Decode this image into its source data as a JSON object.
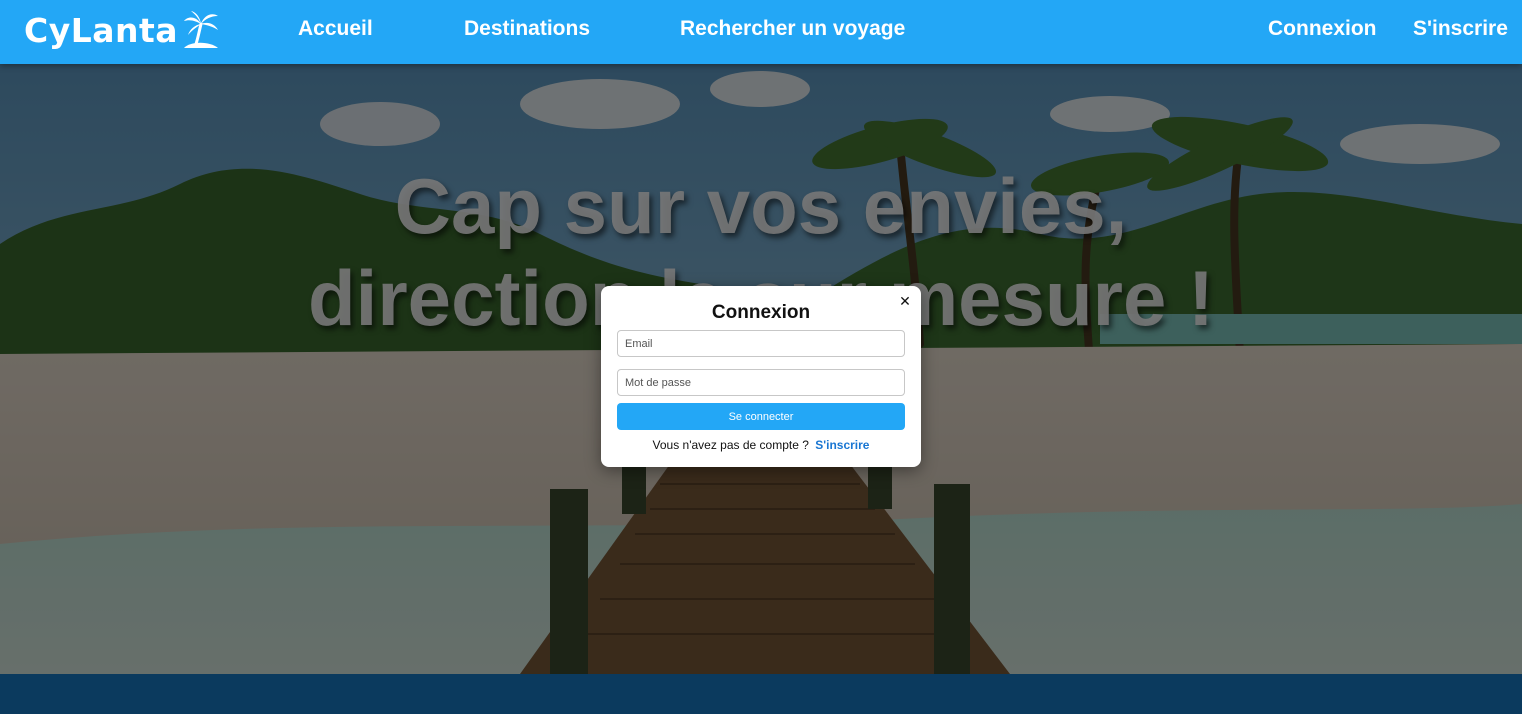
{
  "brand": {
    "name": "CyLanta",
    "logo_icon": "palm-tree-island-icon"
  },
  "nav": {
    "home": "Accueil",
    "destinations": "Destinations",
    "search_trip": "Rechercher un voyage",
    "login": "Connexion",
    "signup": "S'inscrire"
  },
  "hero": {
    "title_line1": "Cap sur vos envies,",
    "title_line2": "direction le sur mesure !"
  },
  "login_modal": {
    "title": "Connexion",
    "close_icon": "close-icon",
    "email_placeholder": "Email",
    "password_placeholder": "Mot de passe",
    "submit_label": "Se connecter",
    "no_account_text": "Vous n'avez pas de compte ?",
    "signup_link": "S'inscrire"
  },
  "colors": {
    "primary": "#23a7f6",
    "footer": "#0b3a5e",
    "link": "#1976d2"
  }
}
